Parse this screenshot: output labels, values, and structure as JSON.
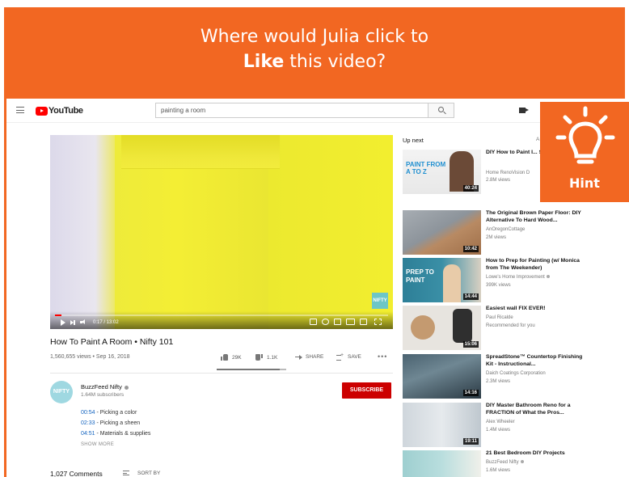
{
  "banner": {
    "line1": "Where would Julia click to",
    "line2_bold": "Like",
    "line2_rest": " this video?"
  },
  "hint": {
    "label": "Hint",
    "icon": "lightbulb-icon"
  },
  "masthead": {
    "logo_text": "YouTube",
    "search_value": "painting a room"
  },
  "player": {
    "time": "0:17 / 13:02",
    "watermark": "NIFTY",
    "progress": 0.02
  },
  "video": {
    "title": "How To Paint A Room • Nifty 101",
    "meta": "1,560,655 views • Sep 16, 2018",
    "likes": "29K",
    "dislikes": "1.1K",
    "share": "SHARE",
    "save": "SAVE",
    "more": "•••"
  },
  "channel": {
    "avatar_text": "NIFTY",
    "name": "BuzzFeed Nifty",
    "subscribers": "1.64M subscribers",
    "subscribe": "SUBSCRIBE",
    "chapters": [
      {
        "time": "00:54",
        "text": " - Picking a color"
      },
      {
        "time": "02:33",
        "text": " - Picking a sheen"
      },
      {
        "time": "04:51",
        "text": " - Materials & supplies"
      }
    ],
    "show_more": "SHOW MORE"
  },
  "comments": {
    "count": "1,027 Comments",
    "sort": "SORT BY"
  },
  "sidebar": {
    "up_next": "Up next",
    "autoplay": "A",
    "items": [
      {
        "title": "DIY How to Paint I... Series A to Z",
        "channel": "Home RenoVision D",
        "views": "2.8M views",
        "duration": "40:24",
        "thumb_text": "PAINT FROM A TO Z"
      },
      {
        "title": "The Original Brown Paper Floor: DIY Alternative To Hard Wood...",
        "channel": "AnOregonCottage",
        "views": "2M views",
        "duration": "10:42"
      },
      {
        "title": "How to Prep for Painting (w/ Monica from The Weekender)",
        "channel": "Lowe's Home Improvement",
        "views": "399K views",
        "duration": "14:44",
        "thumb_text": "PREP TO PAINT"
      },
      {
        "title": "Easiest wall FIX EVER!",
        "channel": "Paul Ricalde",
        "views": "Recommended for you",
        "duration": "15:06"
      },
      {
        "title": "SpreadStone™ Countertop Finishing Kit - Instructional...",
        "channel": "Daich Coatings Corporation",
        "views": "2.3M views",
        "duration": "14:16"
      },
      {
        "title": "DIY Master Bathroom Reno for a FRACTION of What the Pros...",
        "channel": "Alex Wheeler",
        "views": "1.4M views",
        "duration": "19:11"
      },
      {
        "title": "21 Best Bedroom DIY Projects",
        "channel": "BuzzFeed Nifty",
        "views": "1.6M views",
        "duration": ""
      }
    ]
  },
  "colors": {
    "brand_orange": "#f26722",
    "yt_red": "#cc0000",
    "link_blue": "#1565c0"
  }
}
